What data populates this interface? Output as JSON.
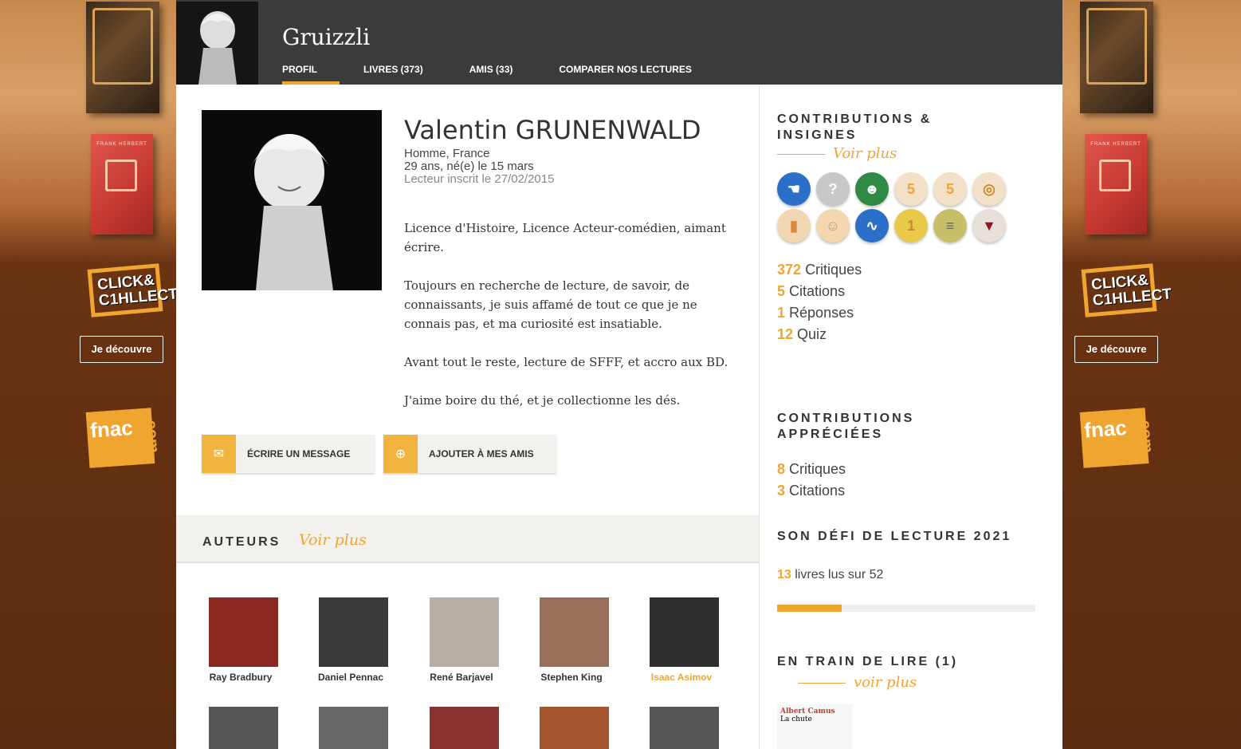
{
  "ads": {
    "click_collect": "CLICK& C1HLLECT",
    "discover_button": "Je découvre",
    "fnac_logo": "fnac",
    "fnac_com": ".com",
    "book_author": "FRANK HERBERT"
  },
  "header": {
    "username": "Gruizzli",
    "tabs": [
      "PROFIL",
      "LIVRES (373)",
      "AMIS (33)",
      "COMPARER NOS LECTURES"
    ]
  },
  "profile": {
    "name": "Valentin GRUNENWALD",
    "gender_country": "Homme, France",
    "age": "29 ans, né(e) le 15 mars",
    "registered": "Lecteur inscrit le 27/02/2015",
    "bio": [
      "Licence d'Histoire, Licence Acteur-comédien, aimant écrire.",
      "Toujours en recherche de lecture, de savoir, de connaissants, je suis affamé de tout ce que je ne connais pas, et ma curiosité est insatiable.",
      "Avant tout le reste, lecture de SFFF, et accro aux BD.",
      "J'aime boire du thé, et je collectionne les dés."
    ],
    "message_button": "ÉCRIRE UN MESSAGE",
    "add_friend_button": "AJOUTER À MES AMIS"
  },
  "auteurs": {
    "title": "AUTEURS",
    "voir_plus": "Voir plus",
    "list": [
      "Ray Bradbury",
      "Daniel Pennac",
      "René Barjavel",
      "Stephen King",
      "Isaac Asimov"
    ]
  },
  "sidebar": {
    "contrib_title": "CONTRIBUTIONS & INSIGNES",
    "voir_plus": "Voir plus",
    "badges": [
      {
        "icon": "hand-pointer-icon",
        "color": "#2b6fc8",
        "mark": "8"
      },
      {
        "icon": "question-icon",
        "color": "#c8c8c8",
        "mark": ""
      },
      {
        "icon": "alien-icon",
        "color": "#2e8a45",
        "mark": "Y"
      },
      {
        "icon": "pages-5-icon",
        "color": "#f3e0c8",
        "mark": ""
      },
      {
        "icon": "quote-5-icon",
        "color": "#f3e0c8",
        "mark": ""
      },
      {
        "icon": "rings-icon",
        "color": "#f3e0c8",
        "mark": ""
      },
      {
        "icon": "book-icon",
        "color": "#f3d7b0",
        "mark": ""
      },
      {
        "icon": "person-icon",
        "color": "#f3d7b0",
        "mark": ""
      },
      {
        "icon": "dragon-icon",
        "color": "#2b6fc8",
        "mark": "Y"
      },
      {
        "icon": "first-book-icon",
        "color": "#e8c94a",
        "mark": ""
      },
      {
        "icon": "stack-icon",
        "color": "#c8c068",
        "mark": ""
      },
      {
        "icon": "blood-icon",
        "color": "#e8e0d8",
        "mark": "8"
      }
    ],
    "stats": [
      {
        "num": "372",
        "label": "Critiques"
      },
      {
        "num": "5",
        "label": "Citations"
      },
      {
        "num": "1",
        "label": "Réponses"
      },
      {
        "num": "12",
        "label": "Quiz"
      }
    ],
    "appreciated_title": "CONTRIBUTIONS APPRÉCIÉES",
    "appreciated": [
      {
        "num": "8",
        "label": "Critiques"
      },
      {
        "num": "3",
        "label": "Citations"
      }
    ],
    "challenge_title": "SON DÉFI DE LECTURE 2021",
    "challenge_num": "13",
    "challenge_text": "livres lus sur 52",
    "challenge_progress": 0.25,
    "reading_title": "EN TRAIN DE LIRE (1)",
    "reading_voir": "voir plus",
    "reading_book_author": "Albert Camus",
    "reading_book_title": "La chute"
  }
}
